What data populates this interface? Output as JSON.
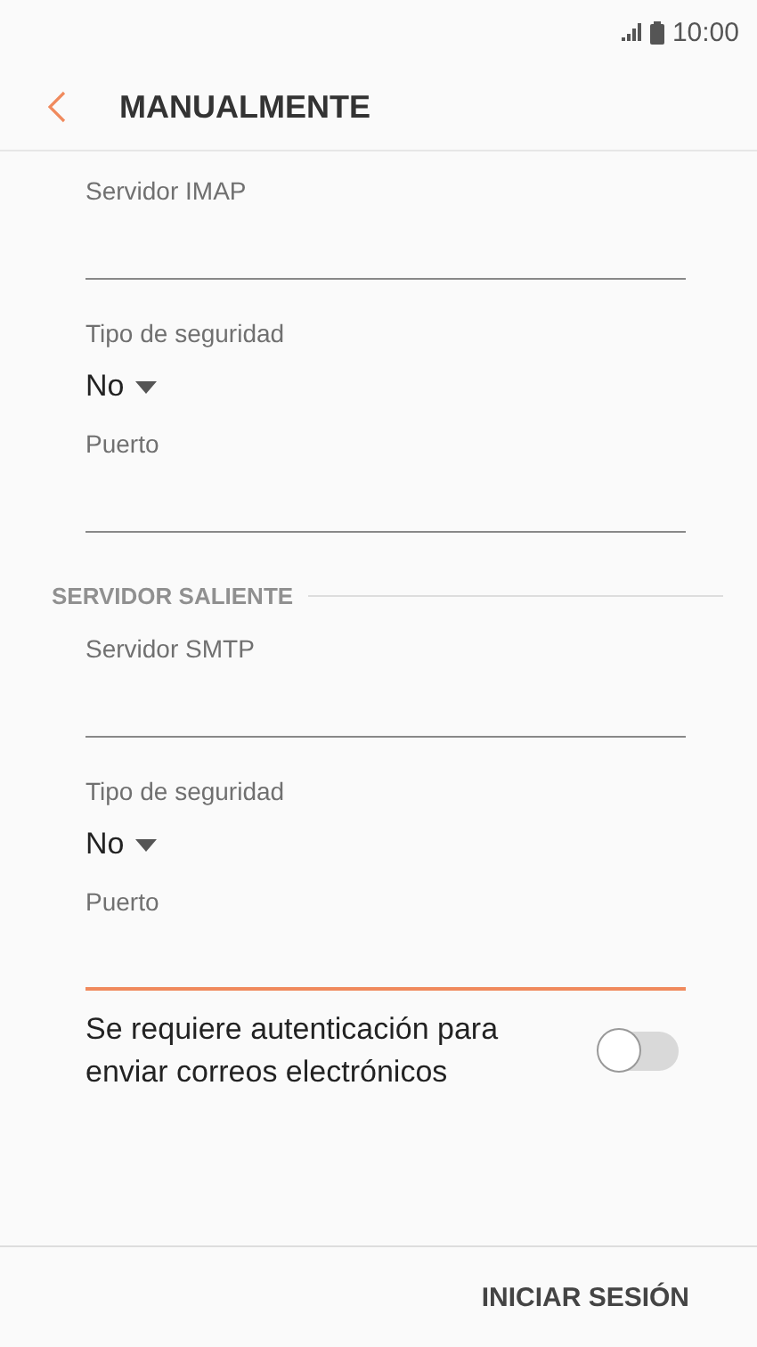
{
  "status_bar": {
    "time": "10:00"
  },
  "header": {
    "title": "MANUALMENTE"
  },
  "items": [
    {
      "kind": "field",
      "label": "Servidor IMAP",
      "focused": false
    },
    {
      "kind": "dropdown",
      "label": "Tipo de seguridad",
      "value": "No"
    },
    {
      "kind": "field",
      "label": "Puerto",
      "focused": false
    },
    {
      "kind": "section",
      "title": "SERVIDOR SALIENTE"
    },
    {
      "kind": "field",
      "label": "Servidor SMTP",
      "focused": false
    },
    {
      "kind": "dropdown",
      "label": "Tipo de seguridad",
      "value": "No"
    },
    {
      "kind": "field",
      "label": "Puerto",
      "focused": true
    },
    {
      "kind": "toggle",
      "label": "Se requiere autenticación para enviar correos electrónicos",
      "on": false
    }
  ],
  "footer": {
    "button": "INICIAR SESIÓN"
  }
}
